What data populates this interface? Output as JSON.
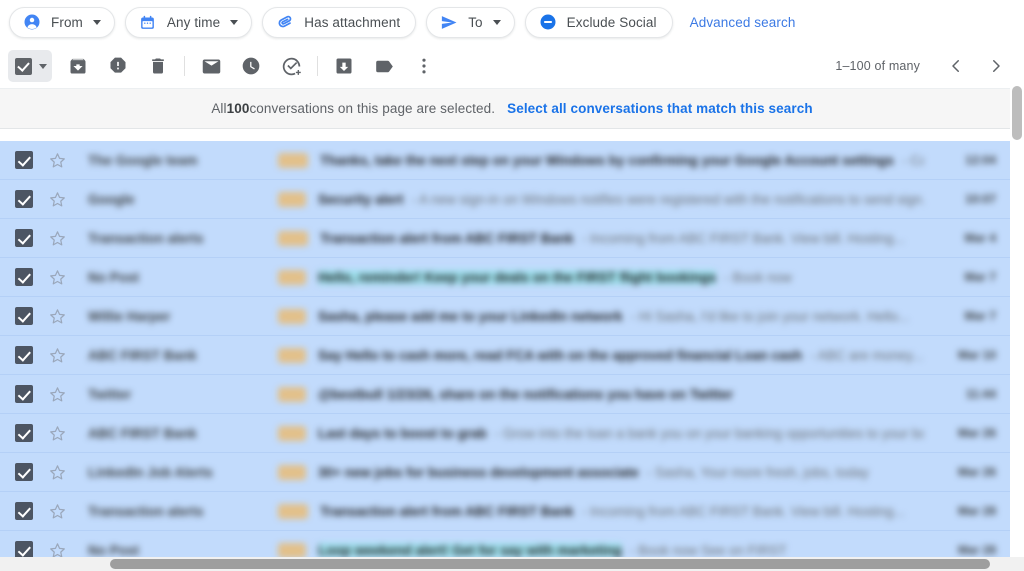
{
  "search_filters": {
    "chips": [
      {
        "label": "From",
        "icon": "person-circle-icon",
        "has_caret": true
      },
      {
        "label": "Any time",
        "icon": "calendar-icon",
        "has_caret": true
      },
      {
        "label": "Has attachment",
        "icon": "paperclip-icon",
        "has_caret": false
      },
      {
        "label": "To",
        "icon": "send-icon",
        "has_caret": true
      },
      {
        "label": "Exclude Social",
        "icon": "minus-circle-icon",
        "has_caret": false
      }
    ],
    "advanced_search_label": "Advanced search"
  },
  "toolbar": {
    "select_all_checkbox": "select-all-checkbox",
    "buttons": [
      {
        "name": "archive-button",
        "tooltip": "Archive"
      },
      {
        "name": "report-spam-button",
        "tooltip": "Report spam"
      },
      {
        "name": "delete-button",
        "tooltip": "Delete"
      },
      {
        "name": "mark-unread-button",
        "tooltip": "Mark as unread"
      },
      {
        "name": "snooze-button",
        "tooltip": "Snooze"
      },
      {
        "name": "add-to-tasks-button",
        "tooltip": "Add to tasks"
      },
      {
        "name": "move-to-button",
        "tooltip": "Move to"
      },
      {
        "name": "labels-button",
        "tooltip": "Labels"
      },
      {
        "name": "more-options-button",
        "tooltip": "More"
      }
    ],
    "pagination": {
      "range_text": "1–100 of many",
      "prev_label": "Newer",
      "next_label": "Older"
    }
  },
  "selection_banner": {
    "prefix": "All ",
    "count": "100",
    "suffix": " conversations on this page are selected.",
    "select_all_link": "Select all conversations that match this search"
  },
  "colors": {
    "accent_blue": "#1a73e8",
    "link_blue": "#3c7ae4",
    "selected_row_bg": "#c2dbfc",
    "banner_bg": "#f6f6f6",
    "label_badge": "#e2c08a",
    "highlight_cyan": "#9fe2ef"
  },
  "mail_list": {
    "rows": [
      {
        "sender": "The Google team",
        "badge_w": 30,
        "subject": "Thanks, take the next step on your Windows by confirming your Google Account settings",
        "snippet": "- Ca",
        "time": "12:04",
        "highlight": false,
        "sub_w": 400
      },
      {
        "sender": "Google",
        "badge_w": 28,
        "subject": "Security alert",
        "snippet": "- A new sign-in on Windows notifies were registered with the notifications to send sign...",
        "time": "10:07",
        "highlight": false,
        "sub_w": 92
      },
      {
        "sender": "Transaction alerts",
        "badge_w": 30,
        "subject": "Transaction alert from ABC FIRST Bank",
        "snippet": "- Incoming from ABC FIRST Bank. View bill. Hosting...",
        "time": "Mar 4",
        "highlight": false,
        "sub_w": 290
      },
      {
        "sender": "No Post",
        "badge_w": 28,
        "subject": "Hello, reminder! Keep your deals on the FIRST flight bookings",
        "snippet": "- Book now",
        "time": "Mar 7",
        "highlight": true,
        "sub_w": 370
      },
      {
        "sender": "Willie Harper",
        "badge_w": 28,
        "subject": "Sasha, please add me to your LinkedIn network",
        "snippet": "- Hi Sasha, I'd like to join your network. Hello...",
        "time": "Mar 7",
        "highlight": false,
        "sub_w": 320
      },
      {
        "sender": "ABC FIRST Bank",
        "badge_w": 28,
        "subject": "Say Hello to cash more, read FCA with on the approved financial Loan cash",
        "snippet": "- ABC are money...",
        "time": "Mar 10",
        "highlight": false,
        "sub_w": 440
      },
      {
        "sender": "Twitter",
        "badge_w": 28,
        "subject": "@bestbull 1/23/26, share on the notifications you have on Twitter",
        "snippet": "",
        "time": "11:44",
        "highlight": false,
        "sub_w": 415
      },
      {
        "sender": "ABC FIRST Bank",
        "badge_w": 28,
        "subject": "Last days to boost to grab",
        "snippet": "- Grow into the loan a bank you on your banking opportunities to your bank...",
        "time": "Mar 26",
        "highlight": false,
        "sub_w": 190
      },
      {
        "sender": "LinkedIn Job Alerts",
        "badge_w": 28,
        "subject": "30+ new jobs for business development associate",
        "snippet": "- Sasha, Your more fresh, jobs, today",
        "time": "Mar 26",
        "highlight": false,
        "sub_w": 330
      },
      {
        "sender": "Transaction alerts",
        "badge_w": 30,
        "subject": "Transaction alert from ABC FIRST Bank",
        "snippet": "- Incoming from ABC FIRST Bank. View bill. Hosting...",
        "time": "Mar 28",
        "highlight": false,
        "sub_w": 290
      },
      {
        "sender": "No Post",
        "badge_w": 28,
        "subject": "Loop weekend alert! Get for say with marketing",
        "snippet": "- Book now See on FIRST",
        "time": "Mar 28",
        "highlight": true,
        "sub_w": 330
      }
    ]
  }
}
